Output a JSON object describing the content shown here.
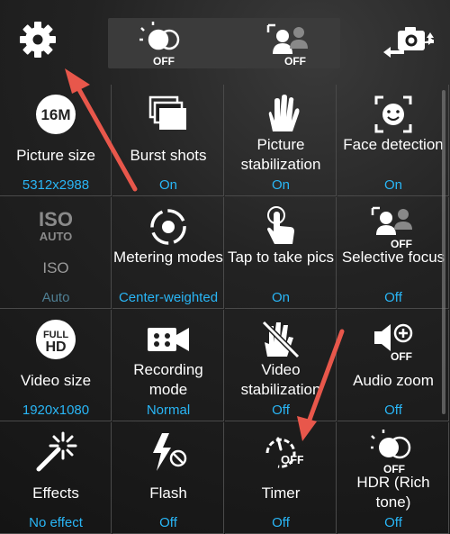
{
  "topbar": {
    "gear": "gear-icon",
    "hdr_mode": {
      "icon": "hdr-icon",
      "state": "OFF"
    },
    "selective_focus_mode": {
      "icon": "selective-focus-icon",
      "state": "OFF"
    },
    "switch_camera": "switch-camera-icon"
  },
  "colors": {
    "accent": "#29b6f6",
    "arrow": "#e8574b"
  },
  "settings": [
    {
      "label": "Picture size",
      "value": "5312x2988",
      "icon": "16m-icon",
      "icon_text": "16M"
    },
    {
      "label": "Burst shots",
      "value": "On",
      "icon": "burst-icon"
    },
    {
      "label": "Picture stabilization",
      "value": "On",
      "icon": "hand-icon"
    },
    {
      "label": "Face detection",
      "value": "On",
      "icon": "face-icon"
    },
    {
      "label": "ISO",
      "value": "Auto",
      "icon": "iso-auto-icon",
      "icon_text": "ISO",
      "icon_text2": "AUTO",
      "disabled": true
    },
    {
      "label": "Metering modes",
      "value": "Center-weighted",
      "icon": "metering-icon"
    },
    {
      "label": "Tap to take pics",
      "value": "On",
      "icon": "tap-icon"
    },
    {
      "label": "Selective focus",
      "value": "Off",
      "icon": "selective-focus-icon",
      "icon_text": "OFF"
    },
    {
      "label": "Video size",
      "value": "1920x1080",
      "icon": "full-hd-icon",
      "icon_text": "FULL",
      "icon_text2": "HD"
    },
    {
      "label": "Recording mode",
      "value": "Normal",
      "icon": "video-camera-icon"
    },
    {
      "label": "Video stabilization",
      "value": "Off",
      "icon": "video-stabilization-icon"
    },
    {
      "label": "Audio zoom",
      "value": "Off",
      "icon": "audio-zoom-icon",
      "icon_text": "OFF"
    },
    {
      "label": "Effects",
      "value": "No effect",
      "icon": "effects-wand-icon"
    },
    {
      "label": "Flash",
      "value": "Off",
      "icon": "flash-off-icon"
    },
    {
      "label": "Timer",
      "value": "Off",
      "icon": "timer-icon",
      "icon_text": "OFF"
    },
    {
      "label": "HDR (Rich tone)",
      "value": "Off",
      "icon": "hdr-icon",
      "icon_text": "OFF"
    }
  ]
}
